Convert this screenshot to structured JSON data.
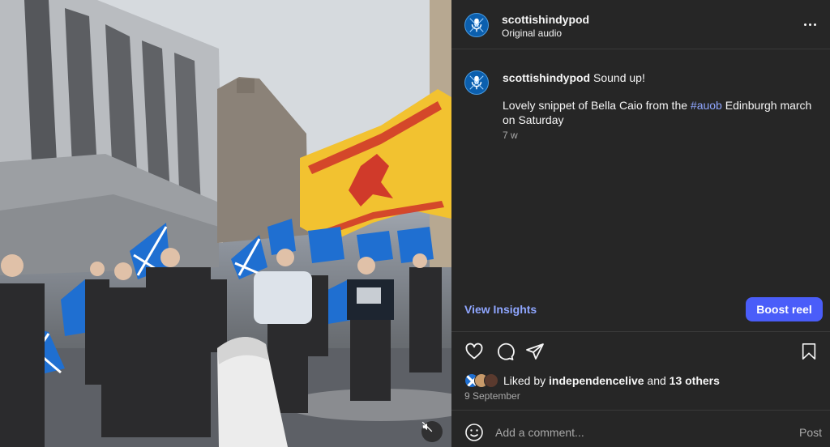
{
  "post": {
    "username": "scottishindypod",
    "audio_label": "Original audio"
  },
  "caption": {
    "username": "scottishindypod",
    "line1": "Sound up!",
    "line2_before": "Lovely snippet of Bella Caio from the ",
    "hashtag": "#auob",
    "line2_after": " Edinburgh march on Saturday",
    "time_ago": "7 w"
  },
  "actions": {
    "view_insights": "View Insights",
    "boost_reel": "Boost reel"
  },
  "likes": {
    "prefix": "Liked by ",
    "liker": "independencelive",
    "middle": " and ",
    "others": "13 others",
    "date": "9 September"
  },
  "comment": {
    "placeholder": "Add a comment...",
    "post_label": "Post"
  },
  "colors": {
    "panel_bg": "#262626",
    "link_blue": "#8fa6ff",
    "boost_blue": "#4a5df9",
    "saltire_blue": "#1f6fd1",
    "lion_rampant_yellow": "#f2c230",
    "lion_red": "#d03a2a"
  },
  "icons": [
    "more-icon",
    "heart-icon",
    "comment-icon",
    "share-icon",
    "bookmark-icon",
    "emoji-icon",
    "mute-icon"
  ]
}
